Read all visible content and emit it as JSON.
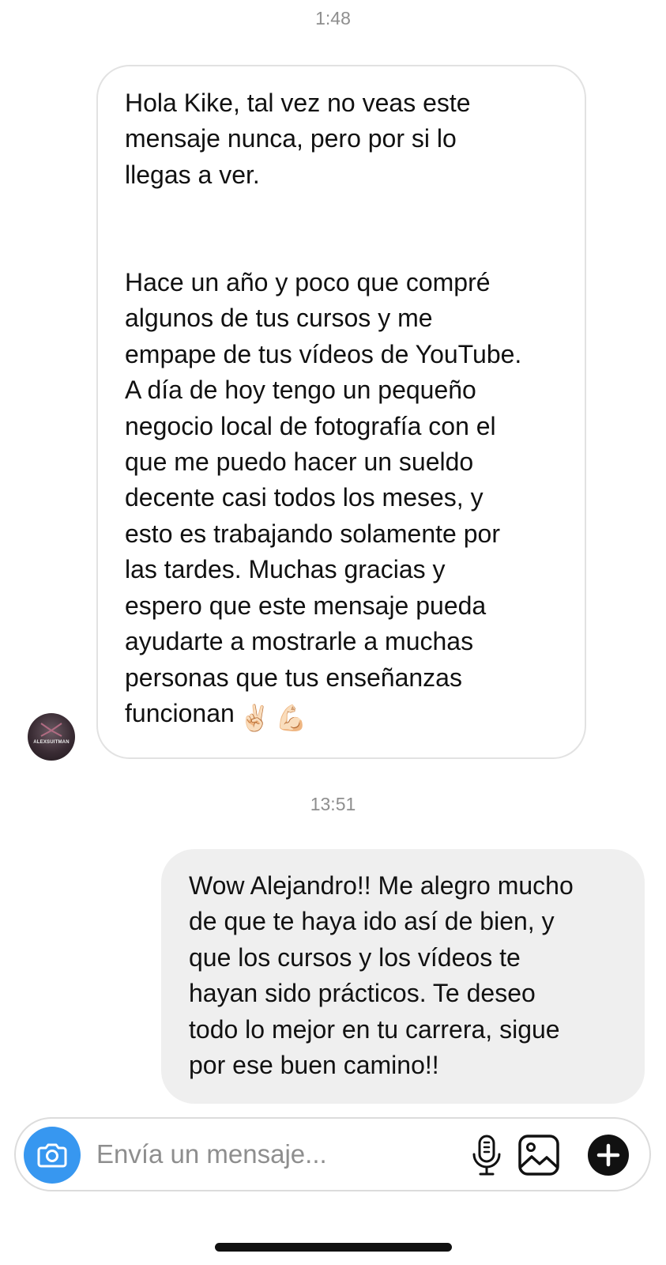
{
  "thread": {
    "timestamp_1": "1:48",
    "timestamp_2": "13:51"
  },
  "incoming_message": {
    "text": "Hola Kike, tal vez no veas este\nmensaje nunca, pero por si lo\nllegas a ver.\n\n\nHace un año y poco que compré\nalgunos de tus cursos y me\nempape de tus vídeos de YouTube.\nA día de hoy tengo un pequeño\nnegocio local de fotografía con el\nque me puedo hacer un sueldo\ndecente casi todos los meses, y\nesto es trabajando solamente por\nlas tardes. Muchas gracias y\nespero que este mensaje pueda\nayudarte a mostrarle a muchas\npersonas que tus enseñanzas\nfuncionan",
    "emoji_1": "✌🏻",
    "emoji_2": "💪🏻",
    "sender_avatar_label": "ALEXSUITMAN"
  },
  "outgoing_message": {
    "text": "Wow Alejandro!! Me alegro mucho\nde que te haya ido así de bien, y\nque los cursos y los vídeos te\nhayan sido prácticos. Te deseo\ntodo lo mejor en tu carrera, sigue\npor ese buen camino!!"
  },
  "composer": {
    "placeholder": "Envía un mensaje...",
    "value": "",
    "camera_icon": "camera-icon",
    "mic_icon": "microphone-icon",
    "gallery_icon": "image-gallery-icon",
    "plus_icon": "plus-circle-icon",
    "accent_color": "#3797f0"
  },
  "colors": {
    "timestamp": "#8e8e8e",
    "incoming_border": "#e2e2e2",
    "outgoing_bg": "#efefef"
  }
}
